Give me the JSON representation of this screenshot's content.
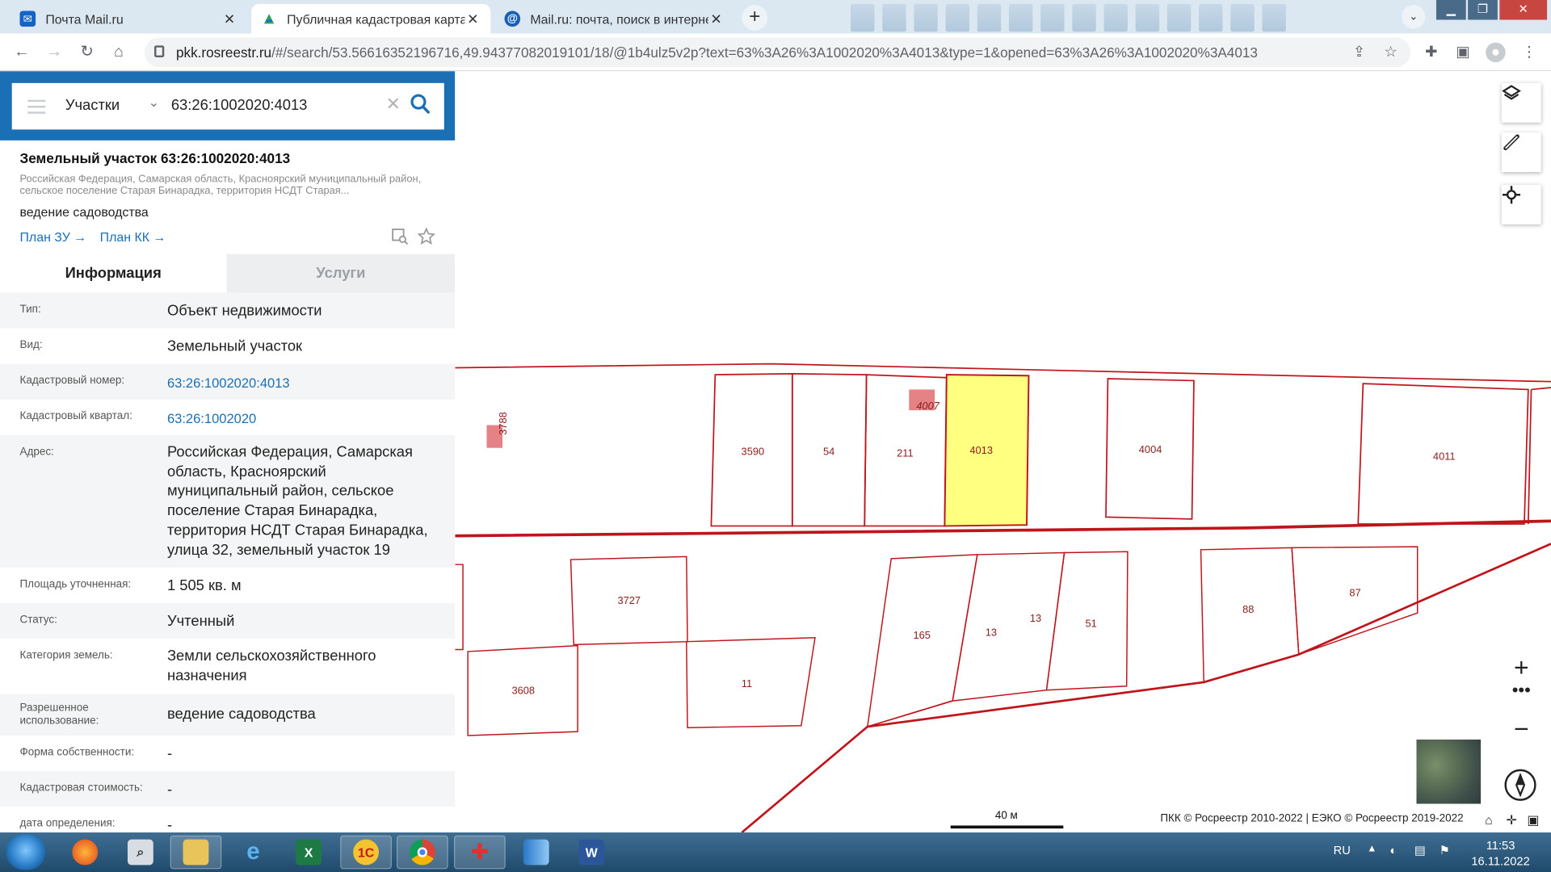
{
  "browser": {
    "tabs": [
      {
        "title": "Почта Mail.ru",
        "icon": "mail-envelope-icon",
        "active": false
      },
      {
        "title": "Публичная кадастровая карта",
        "icon": "rosreestr-icon",
        "active": true
      },
      {
        "title": "Mail.ru: почта, поиск в интернете",
        "icon": "mailru-at-icon",
        "active": false
      }
    ],
    "url_host": "pkk.rosreestr.ru",
    "url_rest": "/#/search/53.56616352196716,49.94377082019101/18/@1b4ulz5v2p?text=63%3A26%3A1002020%3A4013&type=1&opened=63%3A26%3A1002020%3A4013"
  },
  "search": {
    "layer": "Участки",
    "query": "63:26:1002020:4013"
  },
  "object": {
    "title": "Земельный участок 63:26:1002020:4013",
    "address_short": "Российская Федерация, Самарская область, Красноярский муниципальный район, сельское поселение Старая Бинарадка, территория НСДТ Старая...",
    "usage": "ведение садоводства",
    "plan_zu": "План ЗУ →",
    "plan_kk": "План КК →"
  },
  "tabs": {
    "info": "Информация",
    "services": "Услуги"
  },
  "info_rows": [
    {
      "label": "Тип:",
      "value": "Объект недвижимости"
    },
    {
      "label": "Вид:",
      "value": "Земельный участок"
    },
    {
      "label": "Кадастровый номер:",
      "value": "63:26:1002020:4013"
    },
    {
      "label": "Кадастровый квартал:",
      "value": "63:26:1002020"
    },
    {
      "label": "Адрес:",
      "value": "Российская Федерация, Самарская область, Красноярский муниципальный район, сельское поселение Старая Бинарадка, территория НСДТ Старая Бинарадка, улица 32, земельный участок 19"
    },
    {
      "label": "Площадь уточненная:",
      "value": "1 505 кв. м"
    },
    {
      "label": "Статус:",
      "value": "Учтенный"
    },
    {
      "label": "Категория земель:",
      "value": "Земли сельскохозяйственного назначения"
    },
    {
      "label": "Разрешенное использование:",
      "value": "ведение садоводства"
    },
    {
      "label": "Форма собственности:",
      "value": "-"
    },
    {
      "label": "Кадастровая стоимость:",
      "value": "-"
    },
    {
      "label": "дата определения:",
      "value": "-"
    }
  ],
  "map": {
    "parcel_labels": [
      "3788",
      "3590",
      "54",
      "211",
      "4007",
      "4013",
      "4004",
      "4011",
      "3727",
      "3608",
      "11",
      "165",
      "13",
      "13",
      "51",
      "88",
      "87"
    ],
    "selected_parcel": "4013",
    "scale_label": "40 м",
    "copyright": "ПКК © Росреестр 2010-2022 | ЕЭКО © Росреестр 2019-2022",
    "colors": {
      "boundary": "#c0141b",
      "selected_fill": "#ffff80",
      "building": "#e06c70"
    }
  },
  "taskbar": {
    "language": "RU",
    "time": "11:53",
    "date": "16.11.2022"
  }
}
